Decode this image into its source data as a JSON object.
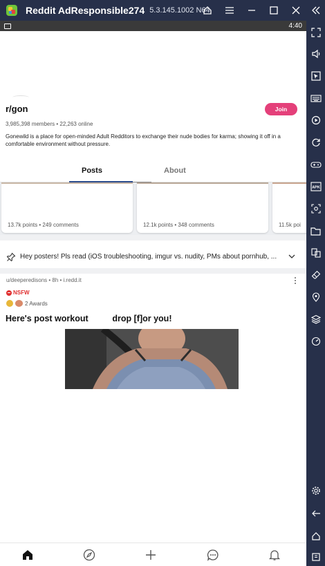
{
  "emulator": {
    "title": "Reddit AdResponsible274",
    "version": "5.3.145.1002 N64",
    "icons": [
      "home-icon",
      "menu-icon",
      "minimize-icon",
      "maximize-icon",
      "close-icon",
      "collapse-sidebar-icon"
    ],
    "sidebar_icons": [
      "fullscreen-icon",
      "volume-icon",
      "pointer-icon",
      "keyboard-icon",
      "record-icon",
      "rotate-icon",
      "gamepad-icon",
      "apk-icon",
      "screenshot-icon",
      "folder-icon",
      "multi-instance-icon",
      "eraser-icon",
      "location-icon",
      "layers-icon",
      "speed-icon",
      "settings-icon",
      "back-icon",
      "home-icon",
      "recents-icon"
    ]
  },
  "status_bar": {
    "time": "4:40"
  },
  "subreddit": {
    "name": "r/gon",
    "join_label": "Join",
    "meta": "3,985,398 members • 22,263 online",
    "description": "Gonewild is a place for open-minded Adult Redditors to exchange their nude bodies for karma; showing it off in a comfortable environment without pressure.",
    "accent_color": "#e4407a"
  },
  "tabs": [
    {
      "label": "Posts",
      "active": true
    },
    {
      "label": "About",
      "active": false
    }
  ],
  "top_cards": [
    {
      "stats": "13.7k points • 249 comments"
    },
    {
      "stats": "12.1k points • 348 comments"
    },
    {
      "stats": "11.5k poi"
    }
  ],
  "pinned": {
    "text": "Hey posters! Pls read (iOS troubleshooting, imgur vs. nudity, PMs about pornhub, ..."
  },
  "post": {
    "meta": "u/deeperedisons • 8h • i.redd.it",
    "nsfw_label": "NSFW",
    "awards_label": "2 Awards",
    "title": "Here's post workout          drop [f]or you!"
  },
  "bottom_nav": [
    "home-icon",
    "compass-icon",
    "add-icon",
    "chat-icon",
    "bell-icon"
  ]
}
